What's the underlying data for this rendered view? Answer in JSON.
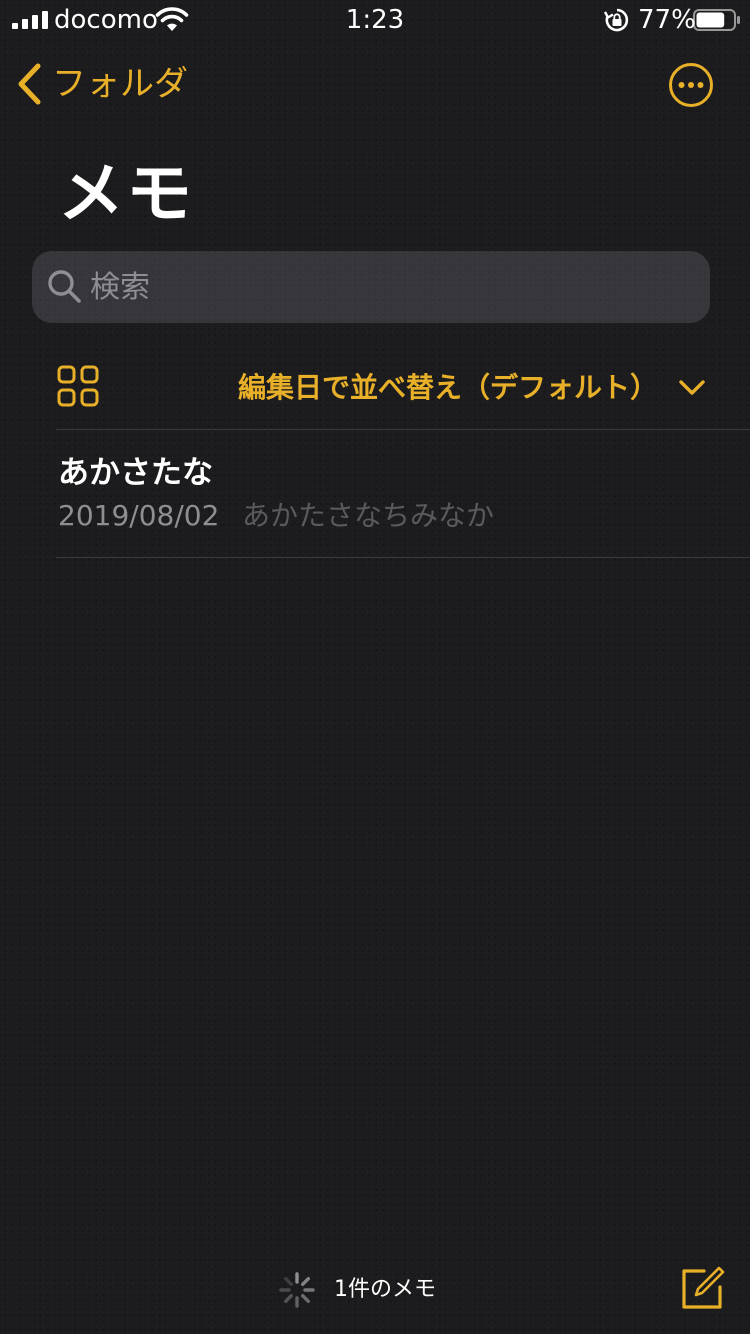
{
  "status_bar": {
    "carrier": "docomo",
    "time": "1:23",
    "battery_percent": "77%",
    "battery_level": 0.77,
    "icons": [
      "signal-icon",
      "wifi-icon",
      "rotation-lock-icon",
      "battery-icon"
    ]
  },
  "nav": {
    "back_label": "フォルダ",
    "more_icon": "ellipsis-circle-icon"
  },
  "page": {
    "title": "メモ"
  },
  "search": {
    "placeholder": "検索",
    "value": ""
  },
  "sort": {
    "label": "編集日で並べ替え（デフォルト）",
    "grid_icon": "gallery-grid-icon"
  },
  "notes": [
    {
      "title": "あかさたな",
      "date": "2019/08/02",
      "preview": "あかたさなちみなか"
    }
  ],
  "toolbar": {
    "note_count": "1件のメモ",
    "compose_icon": "compose-icon"
  },
  "colors": {
    "accent": "#e8b028",
    "background": "#1c1c1e",
    "secondary_text": "#8e8e93"
  }
}
